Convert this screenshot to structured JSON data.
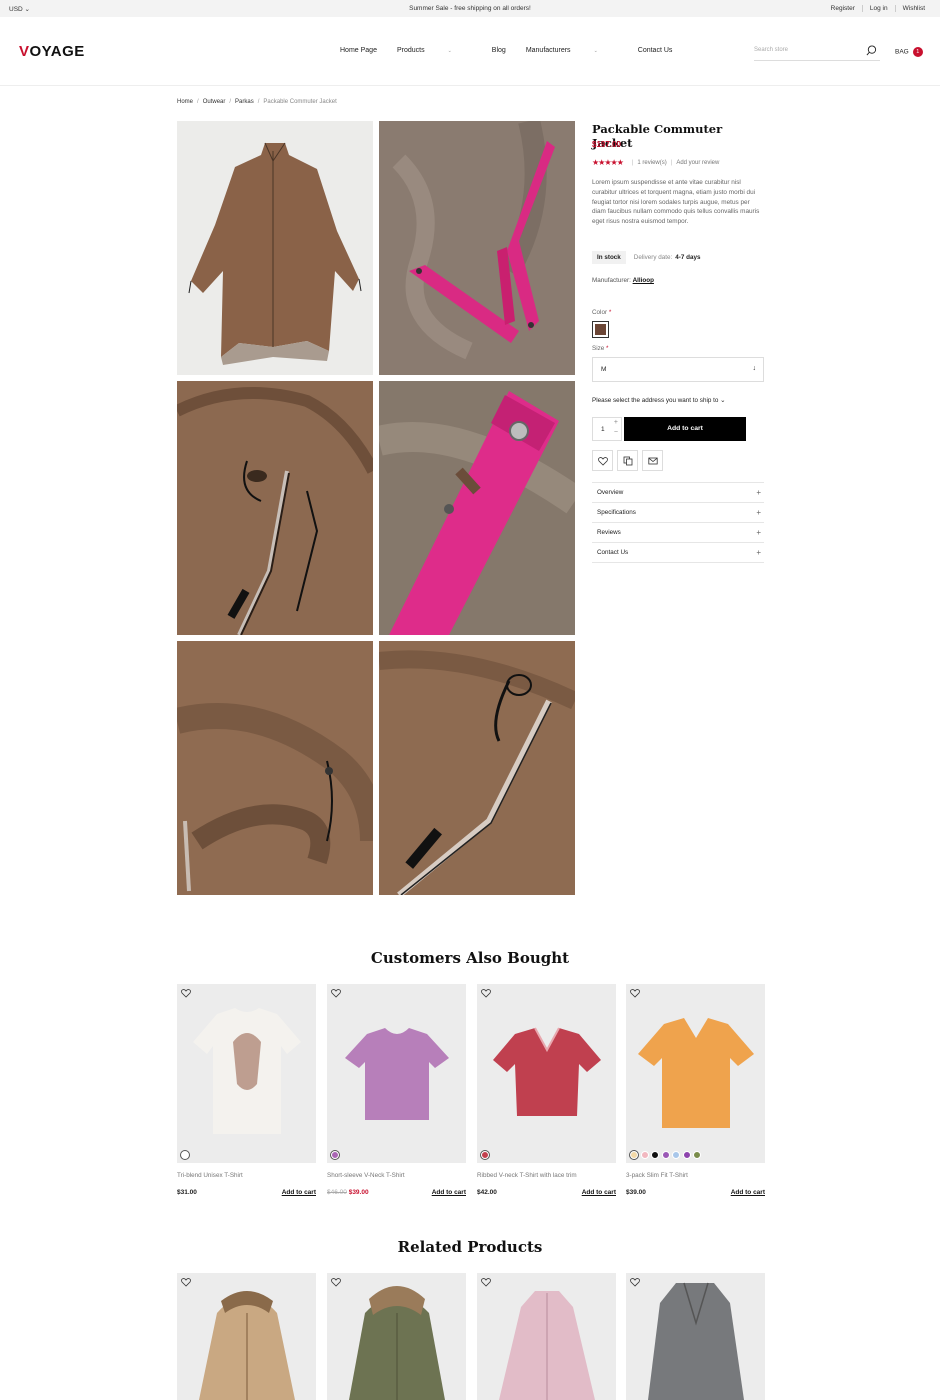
{
  "topbar": {
    "currency": "USD",
    "promo": "Summer Sale - free shipping on all orders!",
    "links": [
      "Register",
      "Log in",
      "Wishlist"
    ]
  },
  "header": {
    "logo_first": "V",
    "logo_rest": "OYAGE",
    "nav": [
      "Home Page",
      "Products",
      "Blog",
      "Manufacturers",
      "Contact Us"
    ],
    "search_placeholder": "Search store",
    "bag_label": "BAG",
    "bag_count": "1"
  },
  "breadcrumb": [
    "Home",
    "Outwear",
    "Parkas",
    "Packable Commuter Jacket"
  ],
  "product": {
    "name": "Packable Commuter Jacket",
    "price": "$197.00",
    "stars": "★★★★★",
    "reviews": "1 review(s)",
    "add_review": "Add your review",
    "description": "Lorem ipsum suspendisse et ante vitae curabitur nisl curabitur ultrices et torquent magna, etiam justo morbi dui feugiat tortor nisi lorem sodales turpis augue, metus per diam faucibus nullam commodo quis tellus convallis mauris eget risus nostra euismod tempor.",
    "stock": "In stock",
    "delivery_label": "Delivery date:",
    "delivery_value": "4-7 days",
    "manufacturer_label": "Manufacturer:",
    "manufacturer": "Allioop",
    "color_label": "Color",
    "color_value": "#6b4636",
    "size_label": "Size",
    "size_value": "M",
    "ship_label": "Please select the address you want to ship to",
    "quantity": "1",
    "add_to_cart": "Add to cart",
    "accordion": [
      "Overview",
      "Specifications",
      "Reviews",
      "Contact Us"
    ]
  },
  "also_bought": {
    "title": "Customers Also Bought",
    "items": [
      {
        "name": "Tri-blend Unisex T-Shirt",
        "price": "$31.00",
        "old_price": "",
        "action": "Add to cart",
        "swatches": [
          "#ffffff"
        ]
      },
      {
        "name": "Short-sleeve V-Neck T-Shirt",
        "price": "$39.00",
        "old_price": "$46.00",
        "action": "Add to cart",
        "swatches": [
          "#a966b4"
        ]
      },
      {
        "name": "Ribbed V-neck T-Shirt with lace trim",
        "price": "$42.00",
        "old_price": "",
        "action": "Add to cart",
        "swatches": [
          "#c2404e"
        ]
      },
      {
        "name": "3-pack Slim Fit T-Shirt",
        "price": "$39.00",
        "old_price": "",
        "action": "Add to cart",
        "swatches": [
          "#f3d9a8",
          "#f2b8c0",
          "#111111",
          "#9b59b6",
          "#a9c7ea",
          "#8e44ad",
          "#7a8c4b"
        ]
      }
    ]
  },
  "related": {
    "title": "Related Products"
  }
}
